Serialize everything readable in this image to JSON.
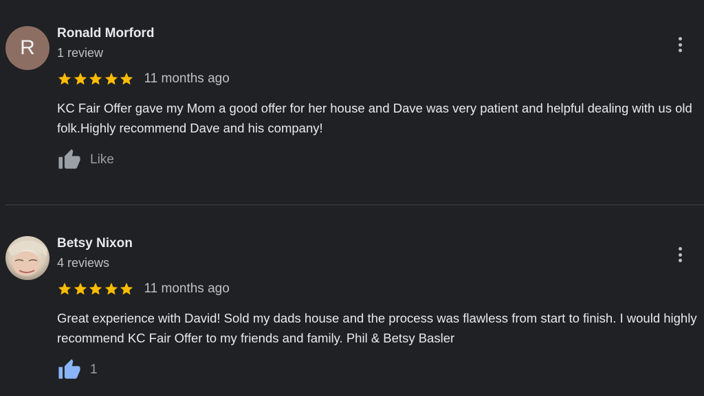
{
  "reviews": [
    {
      "avatar_letter": "R",
      "avatar_color": "#8d6e63",
      "name": "Ronald Morford",
      "review_count": "1 review",
      "rating": 5,
      "time": "11 months ago",
      "text": "KC Fair Offer gave my Mom a good offer for her house and Dave was very patient and helpful dealing with us old folk.Highly recommend Dave and his company!",
      "like_label": "Like",
      "like_icon": "thumb-up-icon",
      "like_color": "#9aa0a6",
      "menu_icon": "more-vert-icon"
    },
    {
      "avatar_type": "photo",
      "name": "Betsy Nixon",
      "review_count": "4 reviews",
      "rating": 5,
      "time": "11 months ago",
      "text": "Great experience with David! Sold my dads house and the process was flawless from start to finish. I would highly recommend KC Fair Offer to my friends and family. Phil & Betsy Basler",
      "like_label": "1",
      "like_icon": "thumb-up-icon",
      "like_color": "#8ab4f8",
      "menu_icon": "more-vert-icon"
    }
  ],
  "colors": {
    "background": "#202124",
    "star": "#fbbc04",
    "divider": "#3c4043"
  }
}
